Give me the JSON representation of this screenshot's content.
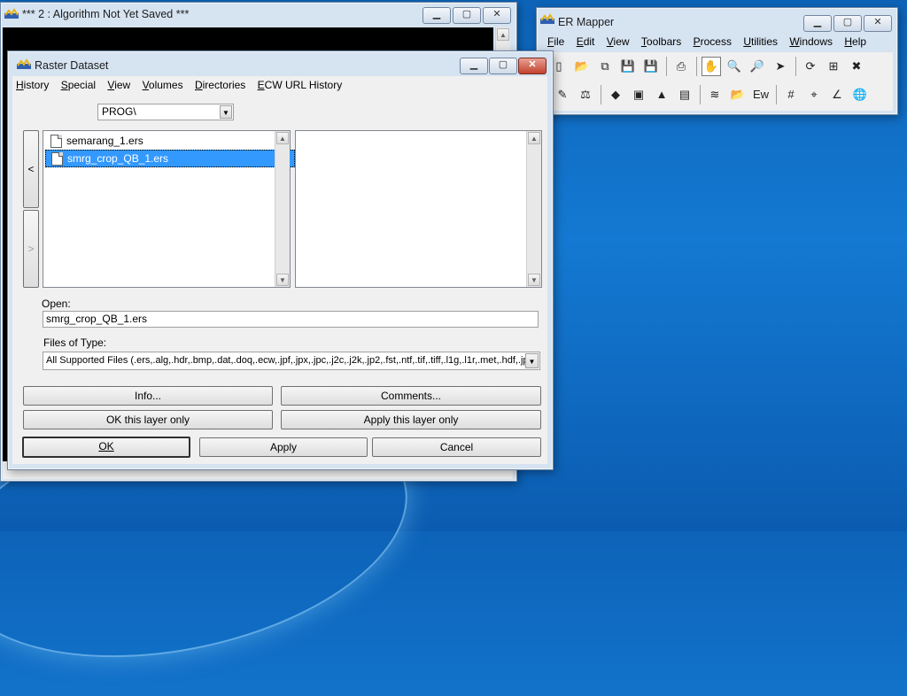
{
  "algorithm_window": {
    "title": "*** 2 : Algorithm Not Yet Saved ***"
  },
  "ermapper": {
    "title": "ER Mapper",
    "menu": [
      "File",
      "Edit",
      "View",
      "Toolbars",
      "Process",
      "Utilities",
      "Windows",
      "Help"
    ],
    "toolbar1": [
      {
        "icon": "new-file-icon",
        "glyph": "▯"
      },
      {
        "icon": "open-folder-icon",
        "glyph": "📂"
      },
      {
        "icon": "open-template-icon",
        "glyph": "⧉"
      },
      {
        "icon": "save-icon",
        "glyph": "💾"
      },
      {
        "icon": "save-as-icon",
        "glyph": "💾"
      },
      {
        "icon": "print-icon",
        "glyph": "⎙"
      },
      {
        "icon": "hand-pan-icon",
        "glyph": "✋"
      },
      {
        "icon": "zoom-icon",
        "glyph": "🔍"
      },
      {
        "icon": "zoom-box-icon",
        "glyph": "🔎"
      },
      {
        "icon": "pointer-icon",
        "glyph": "➤"
      },
      {
        "icon": "refresh-icon",
        "glyph": "⟳"
      },
      {
        "icon": "refresh-99-icon",
        "glyph": "⊞"
      },
      {
        "icon": "stop-icon",
        "glyph": "✖"
      }
    ],
    "toolbar2": [
      {
        "icon": "edit-pencil-icon",
        "glyph": "✎"
      },
      {
        "icon": "balance-icon",
        "glyph": "⚖"
      },
      {
        "icon": "classify-icon",
        "glyph": "◆"
      },
      {
        "icon": "map-composition-icon",
        "glyph": "▣"
      },
      {
        "icon": "vector-icon",
        "glyph": "▲"
      },
      {
        "icon": "gps-icon",
        "glyph": "▤"
      },
      {
        "icon": "layers-icon",
        "glyph": "≋"
      },
      {
        "icon": "open-folder-icon",
        "glyph": "📂"
      },
      {
        "icon": "ew-icon",
        "glyph": "Eᴡ"
      },
      {
        "icon": "grid-icon",
        "glyph": "#"
      },
      {
        "icon": "crosshair-icon",
        "glyph": "⌖"
      },
      {
        "icon": "chart-icon",
        "glyph": "∠"
      },
      {
        "icon": "globe-search-icon",
        "glyph": "🌐"
      }
    ]
  },
  "raster_dialog": {
    "title": "Raster Dataset",
    "menu": [
      "History",
      "Special",
      "View",
      "Volumes",
      "Directories",
      "ECW URL History"
    ],
    "directory": "PROG\\",
    "files": [
      "semarang_1.ers",
      "smrg_crop_QB_1.ers"
    ],
    "selected_index": 1,
    "nav_left": "<",
    "nav_right": ">",
    "open_label": "Open:",
    "open_value": "smrg_crop_QB_1.ers",
    "types_label": "Files of Type:",
    "types_value": "All Supported Files (.ers,.alg,.hdr,.bmp,.dat,.doq,.ecw,.jpf,.jpx,.jpc,.j2c,.j2k,.jp2,.fst,.ntf,.tif,.tiff,.l1g,.l1r,.met,.hdf,.jpg)",
    "buttons": {
      "info": "Info...",
      "comments": "Comments...",
      "ok_layer": "OK this layer only",
      "apply_layer": "Apply this layer only",
      "ok": "OK",
      "apply": "Apply",
      "cancel": "Cancel"
    }
  }
}
